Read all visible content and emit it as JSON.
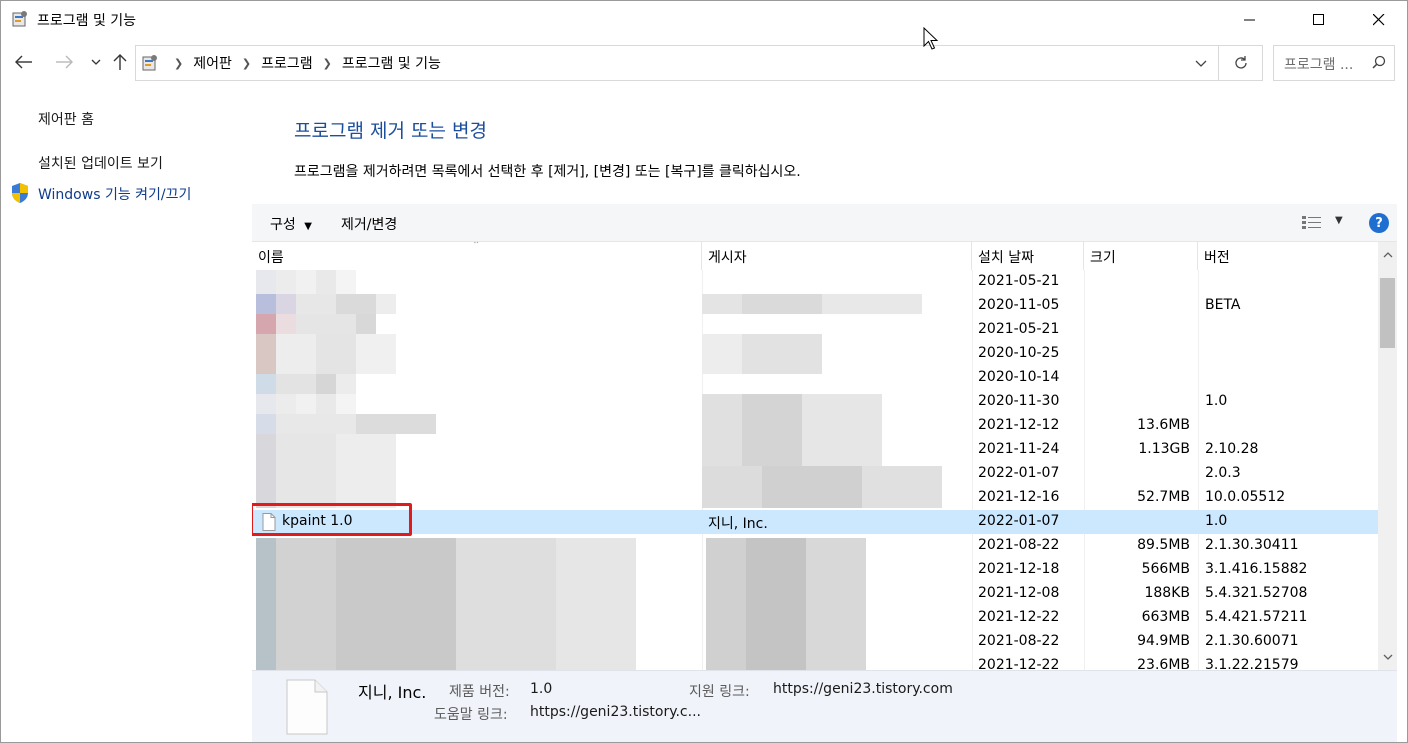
{
  "window": {
    "title": "프로그램 및 기능"
  },
  "address": {
    "crumbs": [
      "제어판",
      "프로그램",
      "프로그램 및 기능"
    ],
    "search_placeholder": "프로그램 ..."
  },
  "left_pane": {
    "home": "제어판 홈",
    "installed_updates": "설치된 업데이트 보기",
    "windows_features": "Windows 기능 켜기/끄기"
  },
  "main": {
    "title": "프로그램 제거 또는 변경",
    "description": "프로그램을 제거하려면 목록에서 선택한 후 [제거], [변경] 또는 [복구]를 클릭하십시오."
  },
  "toolbar": {
    "organize": "구성",
    "uninstall_change": "제거/변경",
    "help": "?"
  },
  "columns": {
    "name": "이름",
    "publisher": "게시자",
    "installed_on": "설치 날짜",
    "size": "크기",
    "version": "버전"
  },
  "rows": [
    {
      "date": "2021-05-21",
      "size": "",
      "version": ""
    },
    {
      "date": "2020-11-05",
      "size": "",
      "version": "BETA"
    },
    {
      "date": "2021-05-21",
      "size": "",
      "version": ""
    },
    {
      "date": "2020-10-25",
      "size": "",
      "version": ""
    },
    {
      "date": "2020-10-14",
      "size": "",
      "version": ""
    },
    {
      "date": "2020-11-30",
      "size": "",
      "version": "1.0"
    },
    {
      "date": "2021-12-12",
      "size": "13.6MB",
      "version": ""
    },
    {
      "date": "2021-11-24",
      "size": "1.13GB",
      "version": "2.10.28"
    },
    {
      "date": "2022-01-07",
      "size": "",
      "version": "2.0.3"
    },
    {
      "date": "2021-12-16",
      "size": "52.7MB",
      "version": "10.0.05512"
    },
    {
      "name": "kpaint 1.0",
      "publisher": "지니, Inc.",
      "date": "2022-01-07",
      "size": "",
      "version": "1.0",
      "selected": true
    },
    {
      "date": "2021-08-22",
      "size": "89.5MB",
      "version": "2.1.30.30411"
    },
    {
      "date": "2021-12-18",
      "size": "566MB",
      "version": "3.1.416.15882"
    },
    {
      "date": "2021-12-08",
      "size": "188KB",
      "version": "5.4.321.52708"
    },
    {
      "date": "2021-12-22",
      "size": "663MB",
      "version": "5.4.421.57211"
    },
    {
      "date": "2021-08-22",
      "size": "94.9MB",
      "version": "2.1.30.60071"
    },
    {
      "date": "2021-12-22",
      "size": "23.6MB",
      "version": "3.1.22.21579"
    }
  ],
  "details": {
    "publisher": "지니, Inc.",
    "product_version_label": "제품 버전:",
    "product_version": "1.0",
    "support_link_label": "지원 링크:",
    "support_link": "https://geni23.tistory.com",
    "help_link_label": "도움말 링크:",
    "help_link": "https://geni23.tistory.c..."
  },
  "colors": {
    "title_blue": "#1b4f9c",
    "selection": "#cce8ff",
    "highlight_red": "#e11b1b"
  }
}
